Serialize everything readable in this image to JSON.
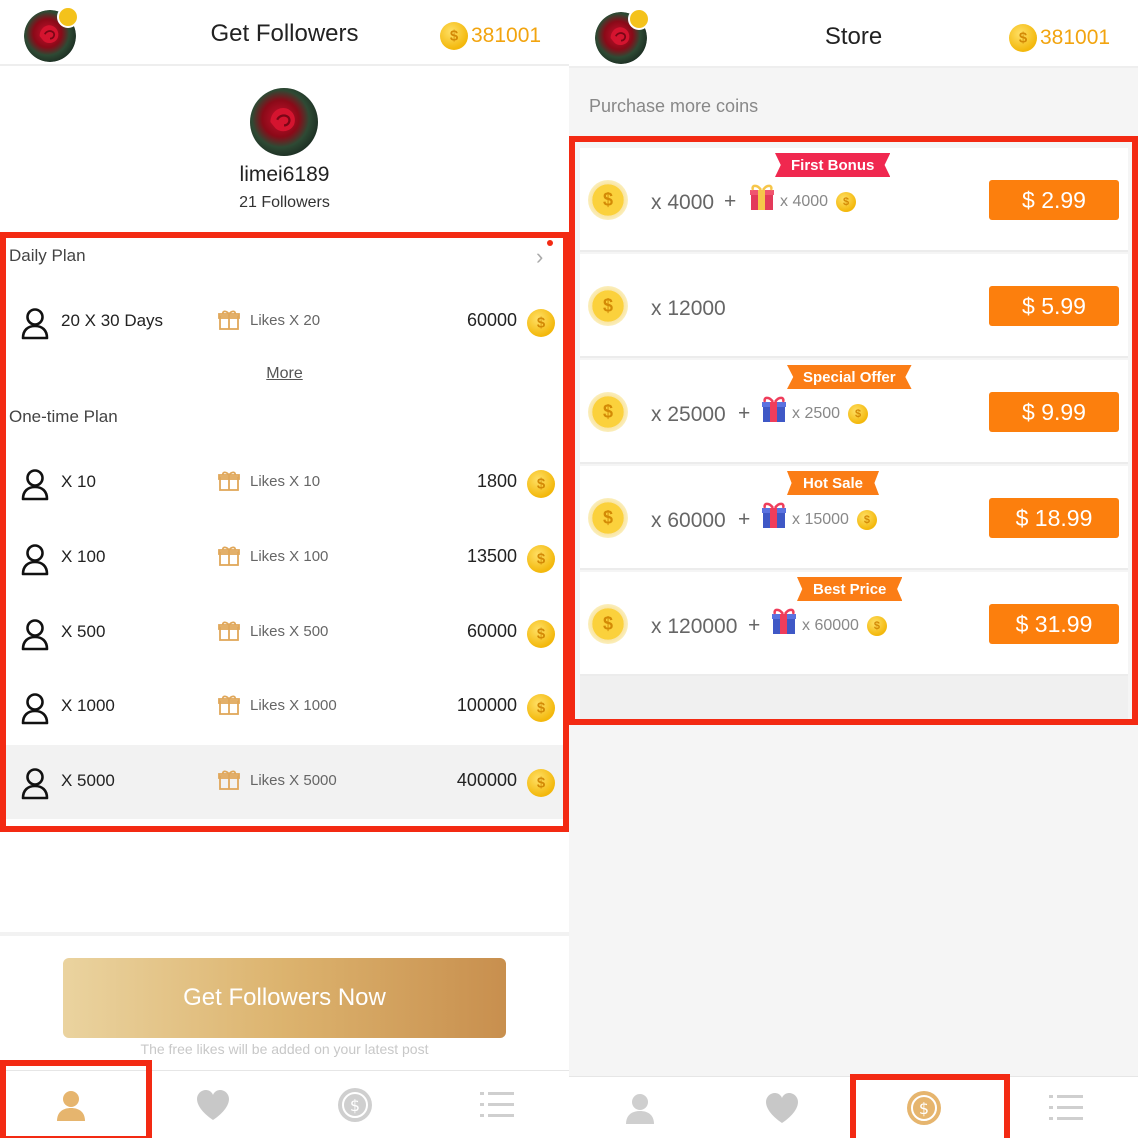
{
  "left": {
    "header": {
      "title": "Get Followers",
      "coins": "381001"
    },
    "profile": {
      "username": "limei6189",
      "followers": "21 Followers"
    },
    "daily_plan": {
      "title": "Daily Plan",
      "row": {
        "count": "20 X 30 Days",
        "likes": "Likes X 20",
        "price": "60000"
      },
      "more": "More"
    },
    "one_time_plan": {
      "title": "One-time Plan",
      "rows": [
        {
          "count": "X 10",
          "likes": "Likes X 10",
          "price": "1800"
        },
        {
          "count": "X 100",
          "likes": "Likes X 100",
          "price": "13500"
        },
        {
          "count": "X 500",
          "likes": "Likes X 500",
          "price": "60000"
        },
        {
          "count": "X 1000",
          "likes": "Likes X 1000",
          "price": "100000"
        },
        {
          "count": "X 5000",
          "likes": "Likes X 5000",
          "price": "400000"
        }
      ]
    },
    "cta": {
      "label": "Get Followers Now",
      "note": "The free likes will be added on your latest post"
    },
    "nav": [
      "user-icon",
      "heart-icon",
      "coin-icon",
      "list-icon"
    ]
  },
  "right": {
    "header": {
      "title": "Store",
      "coins": "381001"
    },
    "subtitle": "Purchase more coins",
    "packages": [
      {
        "amount": "x 4000",
        "plus": "+",
        "tag": "First Bonus",
        "bonus": "x 4000",
        "price": "$ 2.99"
      },
      {
        "amount": "x 12000",
        "plus": "",
        "tag": "",
        "bonus": "",
        "price": "$ 5.99"
      },
      {
        "amount": "x 25000",
        "plus": "+",
        "tag": "Special Offer",
        "bonus": "x 2500",
        "price": "$ 9.99"
      },
      {
        "amount": "x 60000",
        "plus": "+",
        "tag": "Hot Sale",
        "bonus": "x 15000",
        "price": "$ 18.99"
      },
      {
        "amount": "x 120000",
        "plus": "+",
        "tag": "Best Price",
        "bonus": "x 60000",
        "price": "$ 31.99"
      }
    ],
    "nav": [
      "user-icon",
      "heart-icon",
      "coin-icon",
      "list-icon"
    ]
  },
  "colors": {
    "accent": "#fc7f0d",
    "coin": "#f3b80c",
    "highlight": "#f32a13",
    "gold_button": "#dcb36e"
  }
}
